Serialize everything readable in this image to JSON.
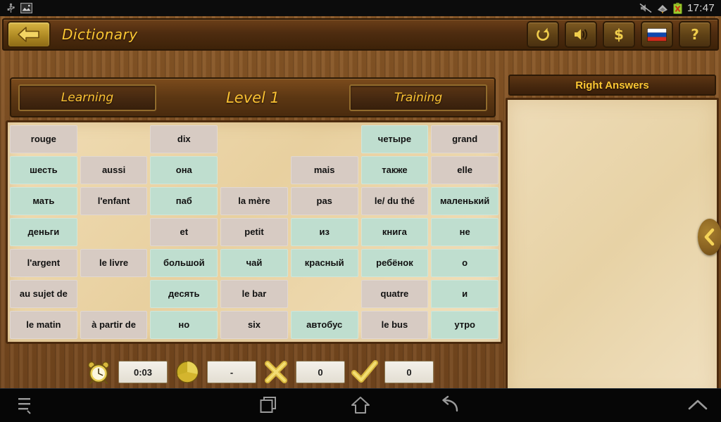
{
  "status_bar": {
    "left_icons": [
      "usb-icon",
      "screenshot-image-icon"
    ],
    "right_icons": [
      "mute-icon",
      "wifi-icon",
      "battery-error-icon"
    ],
    "time": "17:47"
  },
  "topbar": {
    "back_label": "back-arrow-icon",
    "title": "Dictionary",
    "actions": [
      {
        "name": "refresh-button",
        "glyph": "refresh-icon"
      },
      {
        "name": "sound-button",
        "glyph": "speaker-icon"
      },
      {
        "name": "coins-button",
        "glyph": "dollar-icon"
      },
      {
        "name": "language-button",
        "glyph": "russian-flag-icon"
      },
      {
        "name": "help-button",
        "glyph": "question-mark-icon"
      }
    ]
  },
  "levelbar": {
    "learning_tab": "Learning",
    "level_label": "Level 1",
    "training_tab": "Training"
  },
  "grid": {
    "columns": 7,
    "rows": 7,
    "legend": {
      "fr": "french-word",
      "ru": "russian-word",
      "empty": "empty-slot"
    },
    "colors": {
      "french": "#d7cbc3",
      "russian": "#bfdecf",
      "board": "#ecd9ad"
    },
    "cells": [
      {
        "text": "rouge",
        "type": "fr"
      },
      {
        "text": "",
        "type": "empty"
      },
      {
        "text": "dix",
        "type": "fr"
      },
      {
        "text": "",
        "type": "empty"
      },
      {
        "text": "",
        "type": "empty"
      },
      {
        "text": "четыре",
        "type": "ru"
      },
      {
        "text": "grand",
        "type": "fr"
      },
      {
        "text": "шесть",
        "type": "ru"
      },
      {
        "text": "aussi",
        "type": "fr"
      },
      {
        "text": "она",
        "type": "ru"
      },
      {
        "text": "",
        "type": "empty"
      },
      {
        "text": "mais",
        "type": "fr"
      },
      {
        "text": "также",
        "type": "ru"
      },
      {
        "text": "elle",
        "type": "fr"
      },
      {
        "text": "мать",
        "type": "ru"
      },
      {
        "text": "l'enfant",
        "type": "fr"
      },
      {
        "text": "паб",
        "type": "ru"
      },
      {
        "text": "la mère",
        "type": "fr"
      },
      {
        "text": "pas",
        "type": "fr"
      },
      {
        "text": "le/ du thé",
        "type": "fr"
      },
      {
        "text": "маленький",
        "type": "ru"
      },
      {
        "text": "деньги",
        "type": "ru"
      },
      {
        "text": "",
        "type": "empty"
      },
      {
        "text": "et",
        "type": "fr"
      },
      {
        "text": "petit",
        "type": "fr"
      },
      {
        "text": "из",
        "type": "ru"
      },
      {
        "text": "книга",
        "type": "ru"
      },
      {
        "text": "не",
        "type": "ru"
      },
      {
        "text": "l'argent",
        "type": "fr"
      },
      {
        "text": "le livre",
        "type": "fr"
      },
      {
        "text": "большой",
        "type": "ru"
      },
      {
        "text": "чай",
        "type": "ru"
      },
      {
        "text": "красный",
        "type": "ru"
      },
      {
        "text": "ребёнок",
        "type": "ru"
      },
      {
        "text": "о",
        "type": "ru"
      },
      {
        "text": "au sujet de",
        "type": "fr"
      },
      {
        "text": "",
        "type": "empty"
      },
      {
        "text": "десять",
        "type": "ru"
      },
      {
        "text": "le bar",
        "type": "fr"
      },
      {
        "text": "",
        "type": "empty"
      },
      {
        "text": "quatre",
        "type": "fr"
      },
      {
        "text": "и",
        "type": "ru"
      },
      {
        "text": "le matin",
        "type": "fr"
      },
      {
        "text": "à partir de",
        "type": "fr"
      },
      {
        "text": "но",
        "type": "ru"
      },
      {
        "text": "six",
        "type": "fr"
      },
      {
        "text": "автобус",
        "type": "ru"
      },
      {
        "text": "le bus",
        "type": "fr"
      },
      {
        "text": "утро",
        "type": "ru"
      }
    ]
  },
  "stats": {
    "timer_icon": "alarm-clock-icon",
    "timer_value": "0:03",
    "score_icon": "sphere-icon",
    "score_value": "-",
    "wrong_icon": "cross-icon",
    "wrong_value": "0",
    "right_icon": "check-icon",
    "right_value": "0"
  },
  "right_panel": {
    "title": "Right Answers",
    "items": [],
    "collapse_icon": "chevron-left-icon"
  },
  "navbar": {
    "menu": "menu-icon",
    "recents": "recents-icon",
    "home": "home-icon",
    "back": "back-icon",
    "up": "chevron-up-icon"
  }
}
